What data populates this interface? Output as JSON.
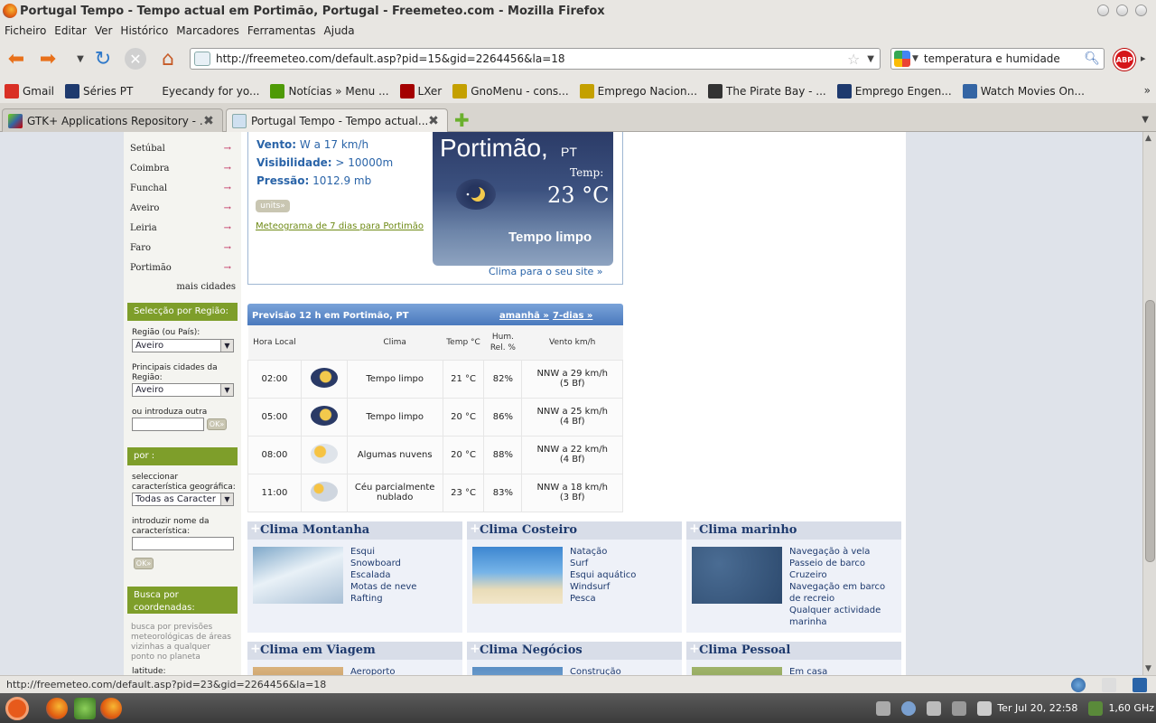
{
  "window": {
    "title": "Portugal Tempo - Tempo actual em Portimão, Portugal - Freemeteo.com - Mozilla Firefox"
  },
  "menu": [
    "Ficheiro",
    "Editar",
    "Ver",
    "Histórico",
    "Marcadores",
    "Ferramentas",
    "Ajuda"
  ],
  "navbar": {
    "url": "http://freemeteo.com/default.asp?pid=15&gid=2264456&la=18",
    "search_query": "temperatura e humidade",
    "abp_label": "ABP"
  },
  "bookmarks": [
    {
      "label": "Gmail",
      "icon": "gmail-icon",
      "color": "#d93025"
    },
    {
      "label": "Séries PT",
      "icon": "z-icon",
      "color": "#1e3a6e"
    },
    {
      "label": "Eyecandy for yo...",
      "icon": "eyecandy-icon",
      "color": "#e8e6e2"
    },
    {
      "label": "Notícias » Menu ...",
      "icon": "star-icon",
      "color": "#4e9a06"
    },
    {
      "label": "LXer",
      "icon": "x-icon",
      "color": "#a40000"
    },
    {
      "label": "GnoMenu - cons...",
      "icon": "lp-icon",
      "color": "#c4a000"
    },
    {
      "label": "Emprego Nacion...",
      "icon": "emprego-icon",
      "color": "#c4a000"
    },
    {
      "label": "The Pirate Bay - ...",
      "icon": "pirate-icon",
      "color": "#333333"
    },
    {
      "label": "Emprego Engen...",
      "icon": "z-icon",
      "color": "#1e3a6e"
    },
    {
      "label": "Watch Movies On...",
      "icon": "film-icon",
      "color": "#3465a4"
    }
  ],
  "tabs": [
    {
      "label": "GTK+ Applications Repository - ...",
      "active": false
    },
    {
      "label": "Portugal Tempo - Tempo actual...",
      "active": true
    }
  ],
  "sidebar": {
    "cities": [
      "Setúbal",
      "Coimbra",
      "Funchal",
      "Aveiro",
      "Leiria",
      "Faro",
      "Portimão"
    ],
    "more_cities": "mais cidades",
    "region_section": {
      "title": "Selecção por Região:",
      "region_label": "Região (ou País):",
      "region_value": "Aveiro",
      "main_cities_label": "Principais cidades da Região:",
      "main_cities_value": "Aveiro",
      "other_city_label": "ou introduza outra cidade:",
      "ok": "OK»"
    },
    "feature_section": {
      "title": "por :",
      "select_label": "seleccionar característica geográfica:",
      "select_value": "Todas as Caracter",
      "name_label": "introduzir nome da característica:",
      "ok": "OK»"
    },
    "coords_section": {
      "title": "Busca por coordenadas:",
      "description": "busca por previsões meteorológicas de áreas vizinhas a qualquer ponto no planeta",
      "latitude_label": "latitude:"
    }
  },
  "current": {
    "wind_label": "Vento:",
    "wind_value": "W a 17 km/h",
    "visibility_label": "Visibilidade:",
    "visibility_value": "> 10000m",
    "pressure_label": "Pressão:",
    "pressure_value": "1012.9 mb",
    "units_button": "units»",
    "meteogram_link": "Meteograma de 7 dias para Portimão",
    "widget": {
      "city": "Portimão,",
      "country": "PT",
      "temp_label": "Temp:",
      "temp_value": "23 °C",
      "condition": "Tempo limpo"
    },
    "site_link": "Clima para o seu site »"
  },
  "forecast": {
    "title": "Previsão 12 h em Portimão, PT",
    "tomorrow_link": "amanhã »",
    "seven_days_link": "7-dias »",
    "headers": {
      "time": "Hora Local",
      "clima": "Clima",
      "temp": "Temp °C",
      "hum": "Hum. Rel. %",
      "wind": "Vento km/h"
    },
    "rows": [
      {
        "time": "02:00",
        "icon": "clear-night-icon",
        "desc": "Tempo limpo",
        "temp": "21 °C",
        "hum": "82%",
        "wind": "NNW a 29 km/h",
        "bf": "(5 Bf)"
      },
      {
        "time": "05:00",
        "icon": "clear-night-icon",
        "desc": "Tempo limpo",
        "temp": "20 °C",
        "hum": "86%",
        "wind": "NNW a 25 km/h",
        "bf": "(4 Bf)"
      },
      {
        "time": "08:00",
        "icon": "partly-cloudy-icon",
        "desc": "Algumas nuvens",
        "temp": "20 °C",
        "hum": "88%",
        "wind": "NNW a 22 km/h",
        "bf": "(4 Bf)"
      },
      {
        "time": "11:00",
        "icon": "cloudy-icon",
        "desc": "Céu parcialmente nublado",
        "temp": "23 °C",
        "hum": "83%",
        "wind": "NNW a 18 km/h",
        "bf": "(3 Bf)"
      }
    ]
  },
  "climate_cards": [
    {
      "title": "Clima Montanha",
      "items": [
        "Esqui",
        "Snowboard",
        "Escalada",
        "Motas de neve",
        "Rafting"
      ]
    },
    {
      "title": "Clima Costeiro",
      "items": [
        "Natação",
        "Surf",
        "Esqui aquático",
        "Windsurf",
        "Pesca"
      ]
    },
    {
      "title": "Clima marinho",
      "items": [
        "Navegação à vela",
        "Passeio de barco",
        "Cruzeiro",
        "Navegação em barco de recreio",
        "Qualquer actividade marinha"
      ]
    },
    {
      "title": "Clima em Viagem",
      "items": [
        "Aeroporto"
      ]
    },
    {
      "title": "Clima Negócios",
      "items": [
        "Construção"
      ]
    },
    {
      "title": "Clima Pessoal",
      "items": [
        "Em casa"
      ]
    }
  ],
  "statusbar": {
    "text": "http://freemeteo.com/default.asp?pid=23&gid=2264456&la=18"
  },
  "taskbar": {
    "clock": "Ter Jul 20, 22:58",
    "cpu": "1,60 GHz"
  }
}
